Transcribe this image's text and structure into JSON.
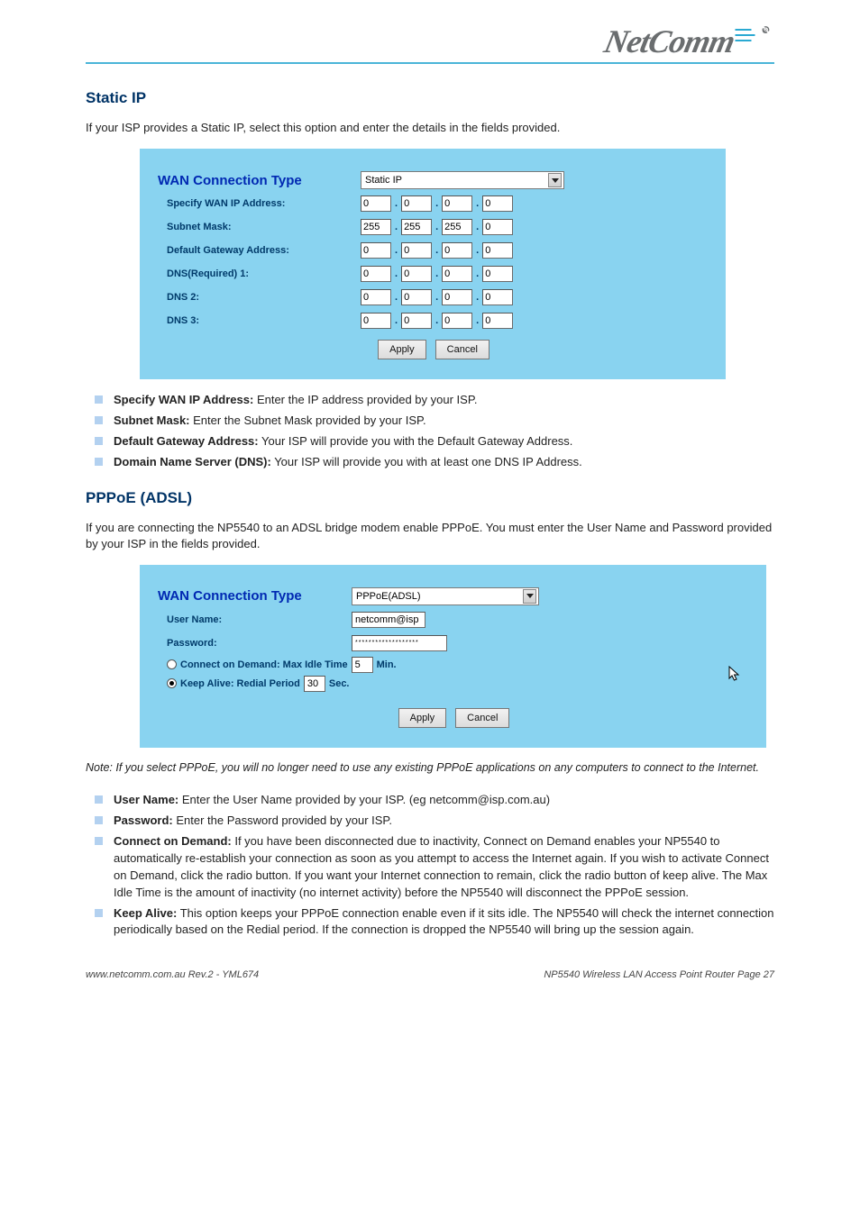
{
  "logo_text": "NetComm",
  "section1": {
    "heading": "Static IP",
    "intro": "If your ISP provides a Static IP, select this option and enter the details in the fields provided."
  },
  "panel1": {
    "title": "WAN Connection Type",
    "select_value": "Static IP",
    "rows": [
      {
        "label": "Specify WAN IP Address:",
        "o": [
          "0",
          "0",
          "0",
          "0"
        ]
      },
      {
        "label": "Subnet Mask:",
        "o": [
          "255",
          "255",
          "255",
          "0"
        ]
      },
      {
        "label": "Default Gateway Address:",
        "o": [
          "0",
          "0",
          "0",
          "0"
        ]
      },
      {
        "label": "DNS(Required)   1:",
        "o": [
          "0",
          "0",
          "0",
          "0"
        ]
      },
      {
        "label": "DNS   2:",
        "o": [
          "0",
          "0",
          "0",
          "0"
        ]
      },
      {
        "label": "DNS   3:",
        "o": [
          "0",
          "0",
          "0",
          "0"
        ]
      }
    ],
    "apply": "Apply",
    "cancel": "Cancel"
  },
  "bullets1": [
    {
      "b": "Specify WAN IP Address:",
      "t": " Enter the IP address provided by your ISP."
    },
    {
      "b": "Subnet Mask:",
      "t": " Enter the Subnet Mask provided by your ISP."
    },
    {
      "b": "Default Gateway Address:",
      "t": " Your ISP will provide you with the Default Gateway Address."
    },
    {
      "b": "Domain Name Server (DNS):",
      "t": " Your ISP will provide you with at least one DNS IP Address."
    }
  ],
  "section2": {
    "heading": "PPPoE (ADSL)",
    "intro": "If you are connecting the NP5540 to an ADSL bridge modem enable PPPoE. You must enter the User Name and Password provided by your ISP in the fields provided."
  },
  "panel2": {
    "title": "WAN Connection Type",
    "select_value": "PPPoE(ADSL)",
    "username_label": "User Name:",
    "username_value": "netcomm@isp",
    "password_label": "Password:",
    "password_value": "*******************",
    "radio_demand_label": "Connect on Demand: Max Idle Time",
    "radio_demand_value": "5",
    "radio_demand_unit": "Min.",
    "radio_keep_label": "Keep Alive: Redial Period",
    "radio_keep_value": "30",
    "radio_keep_unit": "Sec.",
    "apply": "Apply",
    "cancel": "Cancel"
  },
  "section2_note": "Note: If you select PPPoE, you will no longer need to use any existing PPPoE applications on any computers to connect to the Internet.",
  "bullets2": [
    {
      "b": "User Name:",
      "t": " Enter the User Name provided by your ISP. (eg netcomm@isp.com.au)"
    },
    {
      "b": "Password:",
      "t": " Enter the Password provided by your ISP."
    },
    {
      "b": "Connect on Demand:",
      "t": " If you have been disconnected due to inactivity, Connect on Demand enables your NP5540 to automatically re-establish your connection as soon as you attempt to access the Internet again. If you wish to activate Connect on Demand, click the radio button. If you want your Internet connection to remain, click the radio button of keep alive. The Max Idle Time is the amount of inactivity (no internet activity) before the NP5540 will disconnect the PPPoE session."
    },
    {
      "b": "Keep Alive:",
      "t": " This option keeps your PPPoE connection enable even if it sits idle. The NP5540 will check the internet connection periodically based on the Redial period. If the connection is dropped the NP5540 will bring up the session again."
    }
  ],
  "footer": {
    "left": "www.netcomm.com.au   Rev.2 - YML674",
    "right": "NP5540 Wireless LAN Access Point Router   Page 27"
  }
}
